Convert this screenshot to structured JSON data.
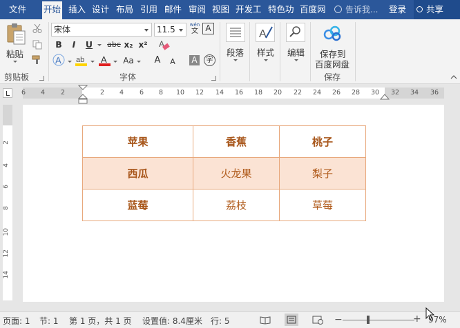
{
  "tabs": [
    "文件",
    "开始",
    "插入",
    "设计",
    "布局",
    "引用",
    "邮件",
    "审阅",
    "视图",
    "开发工",
    "特色功",
    "百度网"
  ],
  "tell_me": "告诉我...",
  "login": "登录",
  "share": "共享",
  "clipboard": {
    "paste_label": "粘贴",
    "group_label": "剪贴板"
  },
  "font": {
    "name": "宋体",
    "size": "11.5",
    "phonetic_top": "wén",
    "phonetic_bottom": "文",
    "border_char": "A",
    "bold": "B",
    "italic": "I",
    "underline": "U",
    "strike": "abc",
    "subscript": "x₂",
    "superscript": "x²",
    "text_effect": "A",
    "highlight_label": "ab",
    "font_color_label": "A",
    "change_case": "Aa",
    "grow": "A",
    "shrink": "A",
    "shading": "A",
    "enclose": "字",
    "group_label": "字体",
    "colors": {
      "highlight": "#ffd400",
      "font_color": "#e02020"
    }
  },
  "paragraph": {
    "label": "段落"
  },
  "styles": {
    "label": "样式"
  },
  "editing": {
    "label": "编辑"
  },
  "save": {
    "label_line1": "保存到",
    "label_line2": "百度网盘",
    "group_label": "保存"
  },
  "ruler": {
    "numbers": [
      "6",
      "4",
      "2",
      "2",
      "4",
      "6",
      "8",
      "10",
      "12",
      "14",
      "16",
      "18",
      "20",
      "22",
      "24",
      "26",
      "28",
      "30",
      "32",
      "34",
      "36"
    ],
    "vertical_numbers": [
      "2",
      "4",
      "6",
      "8",
      "10",
      "12",
      "14"
    ]
  },
  "table": {
    "rows": [
      {
        "shaded": false,
        "cells": [
          {
            "text": "苹果",
            "bold": true
          },
          {
            "text": "香蕉",
            "bold": true
          },
          {
            "text": "桃子",
            "bold": true
          }
        ]
      },
      {
        "shaded": true,
        "cells": [
          {
            "text": "西瓜",
            "bold": true
          },
          {
            "text": "火龙果",
            "bold": false
          },
          {
            "text": "梨子",
            "bold": false
          }
        ]
      },
      {
        "shaded": false,
        "cells": [
          {
            "text": "蓝莓",
            "bold": true
          },
          {
            "text": "荔枝",
            "bold": false
          },
          {
            "text": "草莓",
            "bold": false
          }
        ]
      }
    ],
    "border_color": "#e8a87c",
    "shade_color": "#fbe3d4"
  },
  "status": {
    "page": "页面: 1",
    "section": "节: 1",
    "pages": "第 1 页，共 1 页",
    "setting": "设置值: 8.4厘米",
    "line": "行: 5",
    "zoom": "97%"
  },
  "accent": "#2b579a"
}
